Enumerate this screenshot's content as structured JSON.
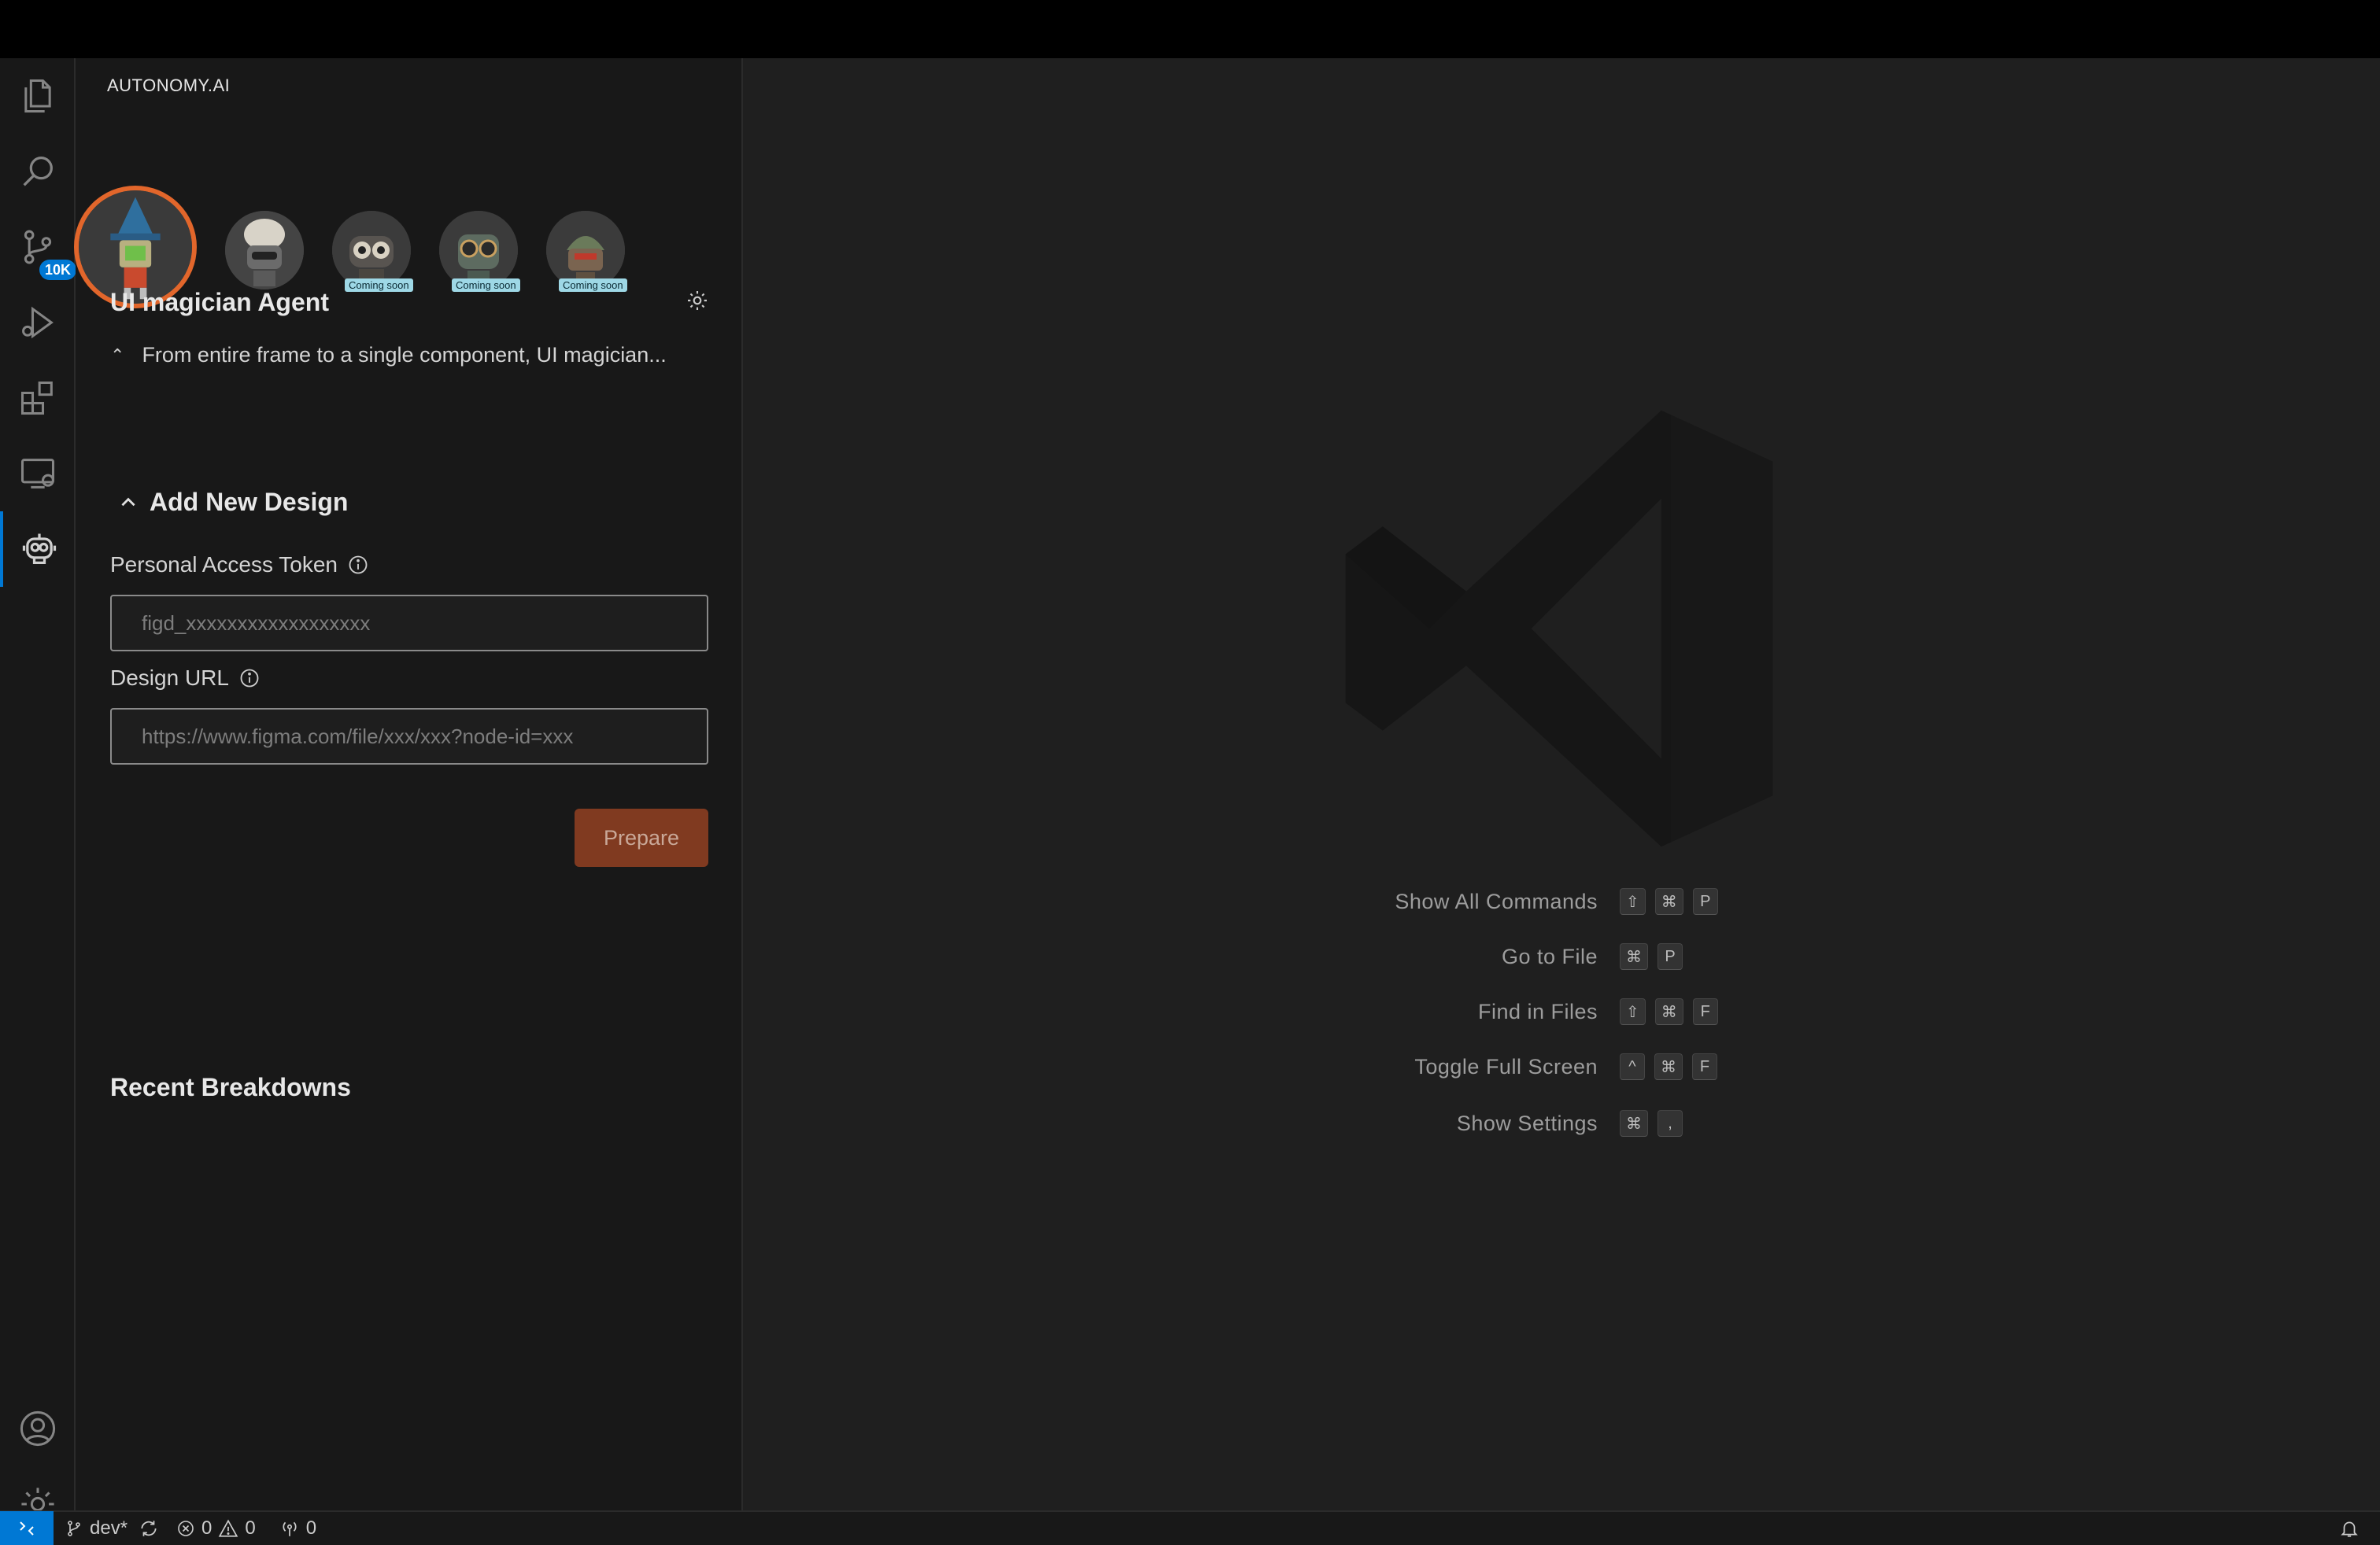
{
  "sidebar": {
    "header": "AUTONOMY.AI",
    "agents": [
      {
        "name": "wizard-agent",
        "selected": true,
        "badge": ""
      },
      {
        "name": "beanie-agent",
        "selected": false,
        "badge": ""
      },
      {
        "name": "goggle-agent",
        "selected": false,
        "badge": "Coming soon"
      },
      {
        "name": "glasses-agent",
        "selected": false,
        "badge": "Coming soon"
      },
      {
        "name": "helmet-agent",
        "selected": false,
        "badge": "Coming soon"
      }
    ],
    "agent_title": "UI magician Agent",
    "agent_desc": "From entire frame to a single component, UI magician...",
    "add_design": {
      "title": "Add New Design",
      "token_label": "Personal Access Token",
      "token_placeholder": "figd_xxxxxxxxxxxxxxxxxx",
      "url_label": "Design URL",
      "url_placeholder": "https://www.figma.com/file/xxx/xxx?node-id=xxx",
      "prepare_label": "Prepare"
    },
    "recent_title": "Recent Breakdowns"
  },
  "activitybar": {
    "scm_badge": "10K"
  },
  "editor": {
    "shortcuts": [
      {
        "label": "Show All Commands",
        "keys": [
          "⇧",
          "⌘",
          "P"
        ]
      },
      {
        "label": "Go to File",
        "keys": [
          "⌘",
          "P"
        ]
      },
      {
        "label": "Find in Files",
        "keys": [
          "⇧",
          "⌘",
          "F"
        ]
      },
      {
        "label": "Toggle Full Screen",
        "keys": [
          "^",
          "⌘",
          "F"
        ]
      },
      {
        "label": "Show Settings",
        "keys": [
          "⌘",
          ","
        ]
      }
    ]
  },
  "statusbar": {
    "branch": "dev*",
    "errors": "0",
    "warnings": "0",
    "ports": "0"
  },
  "colors": {
    "accent": "#0078d4",
    "selected_ring": "#e2662b",
    "prepare_bg": "#803a20"
  }
}
